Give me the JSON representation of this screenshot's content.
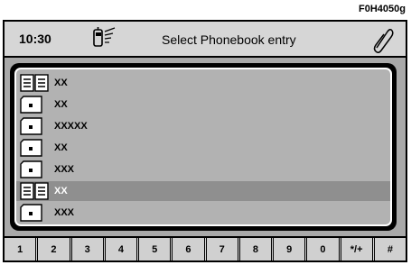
{
  "figure_code": "F0H4050g",
  "header": {
    "time": "10:30",
    "title": "Select Phonebook entry",
    "phone_icon": "phone-signal-icon",
    "clip_icon": "paperclip-icon"
  },
  "entries": [
    {
      "label": "XX",
      "icon": "phonebook-icon",
      "selected": false
    },
    {
      "label": "XX",
      "icon": "sim-card-icon",
      "selected": false
    },
    {
      "label": "XXXXX",
      "icon": "sim-card-icon",
      "selected": false
    },
    {
      "label": "XX",
      "icon": "sim-card-icon",
      "selected": false
    },
    {
      "label": "XXX",
      "icon": "sim-card-icon",
      "selected": false
    },
    {
      "label": "XX",
      "icon": "phonebook-icon",
      "selected": true
    },
    {
      "label": "XXX",
      "icon": "sim-card-icon",
      "selected": false
    }
  ],
  "keypad": {
    "keys": [
      "1",
      "2",
      "3",
      "4",
      "5",
      "6",
      "7",
      "8",
      "9",
      "0",
      "*/+",
      "#"
    ]
  }
}
